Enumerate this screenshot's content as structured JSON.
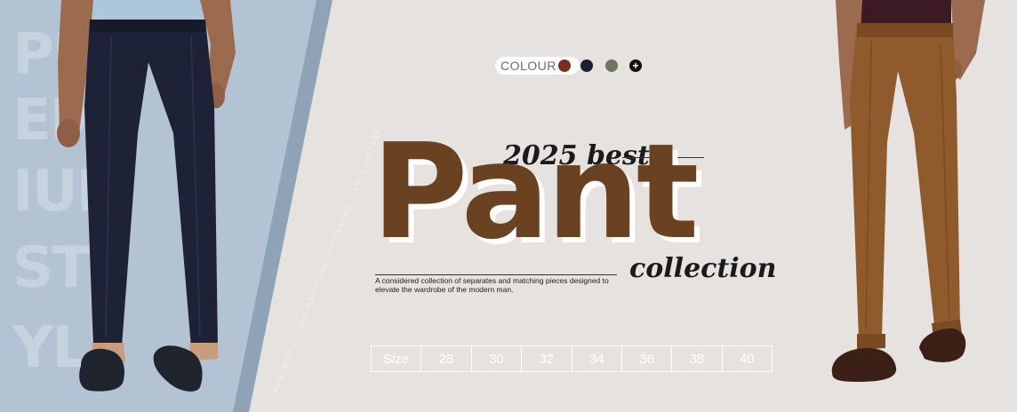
{
  "background_words": [
    "PR",
    "EM",
    "IUM",
    "ST",
    "YLE"
  ],
  "material_text": "80% WOOL / 16% RECYCLED POLYESTER / 4% ELASTANE",
  "colour": {
    "label": "COLOUR",
    "swatches": [
      "#7a2f1e",
      "#1b2030",
      "#6e7560"
    ],
    "add_icon": "+"
  },
  "headline": {
    "kicker": "2025 best",
    "title": "Pant",
    "suffix": "collection"
  },
  "tagline": "A considered collection of separates and matching pieces designed to elevate the wardrobe of the modern man.",
  "sizes": {
    "label": "Size",
    "options": [
      "28",
      "30",
      "32",
      "34",
      "36",
      "38",
      "40"
    ]
  },
  "colors": {
    "background": "#e6e2e0",
    "left_panel": "#b4c3d3",
    "title_brown": "#6b4221",
    "navy_pant": "#1d2236",
    "brown_pant": "#8f5b2c"
  }
}
